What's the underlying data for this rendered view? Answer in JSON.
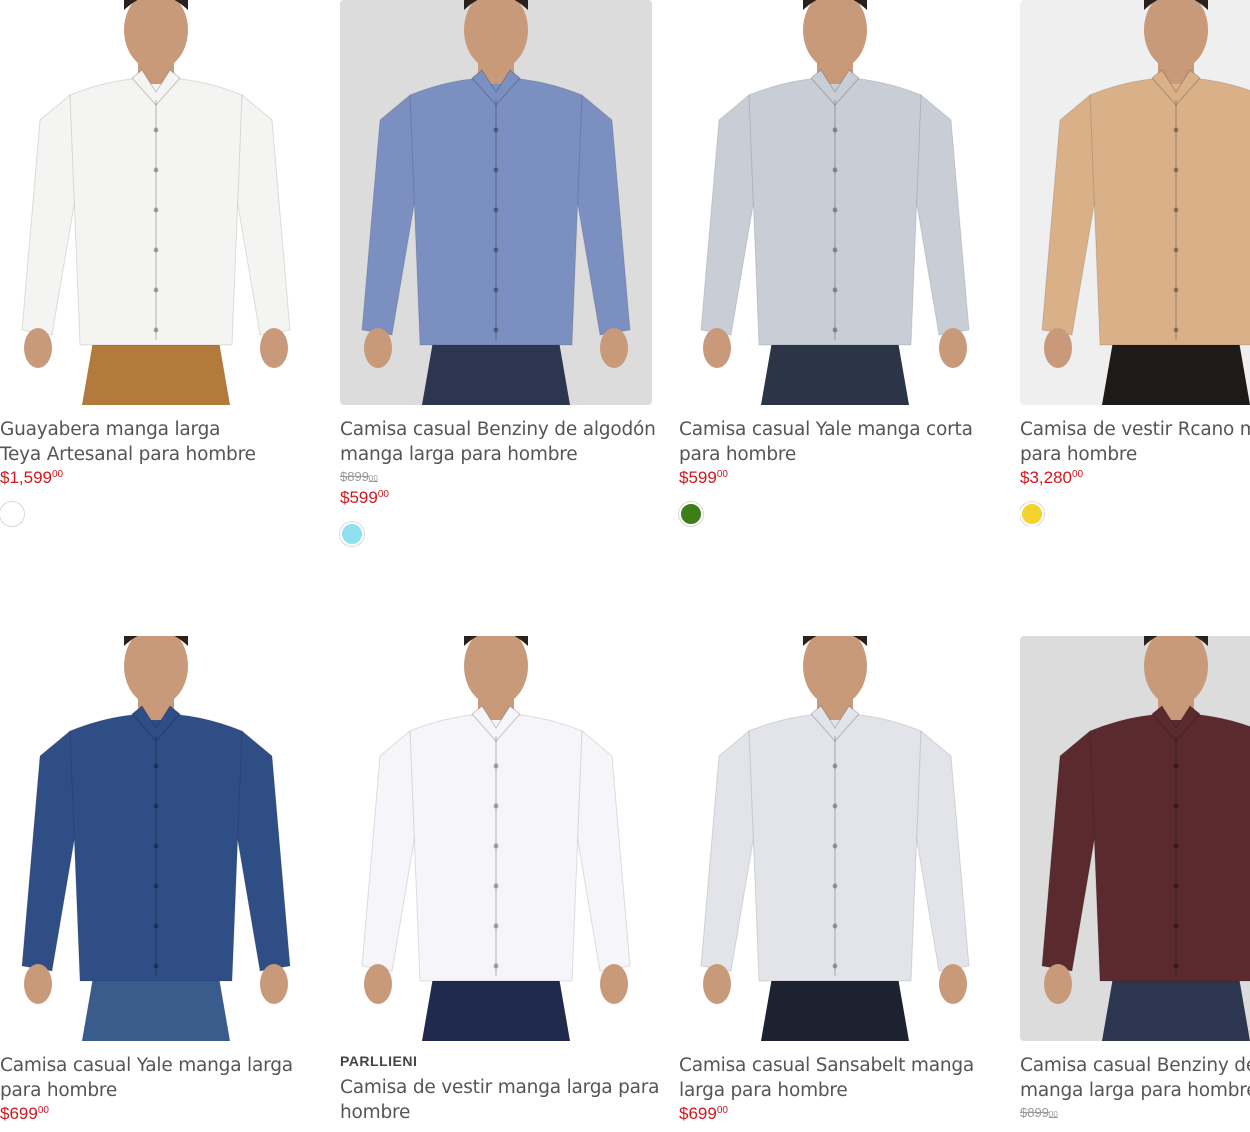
{
  "products": [
    {
      "title_line1": "Guayabera manga larga",
      "title_line2": "Teya Artesanal para hombre",
      "price": "$1,599",
      "price_cents": "00",
      "swatch_color": "#ffffff",
      "shirt_color": "#f4f4f2",
      "bg_color": "#ffffff",
      "pants_color": "#b37a3e"
    },
    {
      "title_line1": "Camisa casual Benziny de algodón",
      "title_line2": "manga larga para hombre",
      "old_price": "$899",
      "old_price_cents": "00",
      "price": "$599",
      "price_cents": "00",
      "swatch_color": "#8fe0ee",
      "shirt_color": "#7b8fc0",
      "bg_color": "#dcdcdc",
      "pants_color": "#2c3650"
    },
    {
      "title_line1": "Camisa casual Yale manga corta",
      "title_line2": "para hombre",
      "price": "$599",
      "price_cents": "00",
      "swatch_color": "#3e7d1a",
      "shirt_color": "#c9ced6",
      "bg_color": "#ffffff",
      "pants_color": "#2c3448"
    },
    {
      "title_line1": "Camisa de vestir Rcano manga larga",
      "title_line2": "para hombre",
      "price": "$3,280",
      "price_cents": "00",
      "swatch_color": "#f2d22b",
      "shirt_color": "#d9b088",
      "bg_color": "#efefef",
      "pants_color": "#1e1a18"
    },
    {
      "title_line1": "Camisa casual Yale manga larga",
      "title_line2": "para hombre",
      "price": "$699",
      "price_cents": "00",
      "shirt_color": "#2f4e86",
      "bg_color": "#ffffff",
      "pants_color": "#3a5c8c"
    },
    {
      "brand": "PARLLIENI",
      "title_line1": "Camisa de vestir manga larga para",
      "title_line2": "hombre",
      "shirt_color": "#f6f6fa",
      "bg_color": "#ffffff",
      "pants_color": "#1f2a4c"
    },
    {
      "title_line1": "Camisa casual Sansabelt manga",
      "title_line2": "larga para hombre",
      "price": "$699",
      "price_cents": "00",
      "shirt_color": "#e2e4ea",
      "bg_color": "#ffffff",
      "pants_color": "#1c2230"
    },
    {
      "title_line1": "Camisa casual Benziny de algodón",
      "title_line2": "manga larga para hombre",
      "old_price": "$899",
      "old_price_cents": "00",
      "shirt_color": "#5a2a2e",
      "bg_color": "#dcdcdc",
      "pants_color": "#2c3650"
    }
  ]
}
